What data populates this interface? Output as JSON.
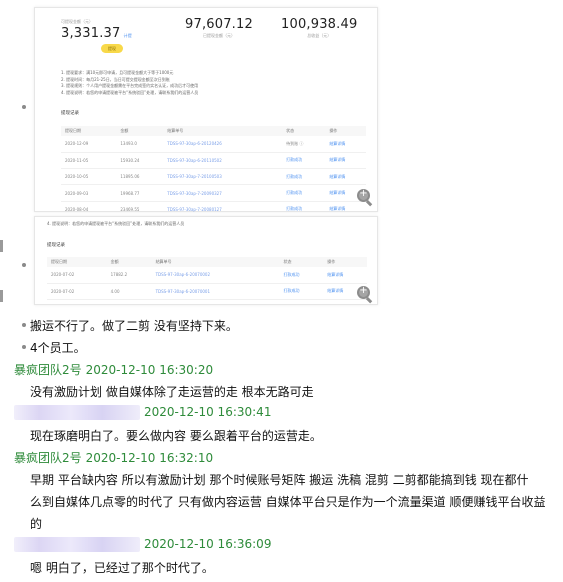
{
  "screenshot1": {
    "stats": [
      {
        "value": "3,331.37",
        "label": "可提现金额（元）",
        "suffix": "计提"
      },
      {
        "value": "97,607.12",
        "label": "已提现金额（元）"
      },
      {
        "value": "100,938.49",
        "label": "总收益（元）"
      }
    ],
    "withdraw_button": "提现",
    "notes": [
      "1. 提现要求：满10元即可申请，且可提现金额大于等于1000元",
      "2. 提现时间：每月21-25日，当日可提交提现金额至次日到账",
      "3. 提现规则：个人用户提现金额需在平台完成签约实名认证，成功后才可使用",
      "4. 提现说明：若您的申请提现被平台“系统驳回”处理，请联系我们的运营人员"
    ],
    "section_title": "提现记录",
    "table": {
      "headers": [
        "提现日期",
        "金额",
        "结算单号",
        "状态",
        "操作"
      ],
      "rows": [
        [
          "2020-12-09",
          "13493.0",
          "TDSS-97-30ap-6-20120426",
          "待到账 ⓘ",
          "结算详情"
        ],
        [
          "2020-11-05",
          "15930.24",
          "TDSS-97-30ap-6-20110502",
          "打款成功",
          "结算详情"
        ],
        [
          "2020-10-05",
          "11895.06",
          "TDSS-97-30ap-7-20100503",
          "打款成功",
          "结算详情"
        ],
        [
          "2020-09-03",
          "19968.77",
          "TDSS-97-30ap-7-20090327",
          "打款成功",
          "结算详情"
        ],
        [
          "2020-08-04",
          "23469.55",
          "TDSS-97-30ap-7-20080127",
          "打款成功",
          "结算详情"
        ]
      ]
    }
  },
  "screenshot2": {
    "note": "4. 提现说明：若您的申请提现被平台“系统驳回”处理，请联系我们的运营人员",
    "section_title": "提现记录",
    "table": {
      "headers": [
        "提现日期",
        "金额",
        "结算单号",
        "状态",
        "操作"
      ],
      "rows": [
        [
          "2020-07-02",
          "17882.2",
          "TDSS-97-30ap-6-20070002",
          "打款成功",
          "结算详情"
        ],
        [
          "2020-07-02",
          "4.00",
          "TDSS-97-30ap-6-20070001",
          "打款成功",
          "结算详情"
        ]
      ]
    }
  },
  "chat": {
    "lines": [
      "搬运不行了。做了二剪 没有坚持下来。",
      "4个员工。"
    ],
    "messages": [
      {
        "sender": "暴疯团队2号",
        "time": "2020-12-10 16:30:20",
        "text": [
          "没有激励计划 做自媒体除了走运营的走  根本无路可走"
        ]
      },
      {
        "sender": "",
        "time": "2020-12-10 16:30:41",
        "text": [
          "现在琢磨明白了。要么做内容 要么跟着平台的运营走。"
        ]
      },
      {
        "sender": "暴疯团队2号",
        "time": "2020-12-10 16:32:10",
        "text": [
          "早期  平台缺内容  所以有激励计划    那个时候账号矩阵  搬运  洗稿   混剪   二剪都能搞到钱   现在都什",
          "么到自媒体几点零的时代了     只有做内容运营   自媒体平台只是作为一个流量渠道  顺便赚钱平台收益",
          "的"
        ]
      },
      {
        "sender": "",
        "time": "2020-12-10 16:36:09",
        "text": [
          "嗯 明白了，已经过了那个时代了。"
        ]
      }
    ]
  },
  "colors": {
    "sender_green": "#2e8b3a",
    "link_blue": "#4a8ff0",
    "withdraw_yellow": "#f8d94a"
  },
  "icons": [
    "zoom-in-icon"
  ]
}
